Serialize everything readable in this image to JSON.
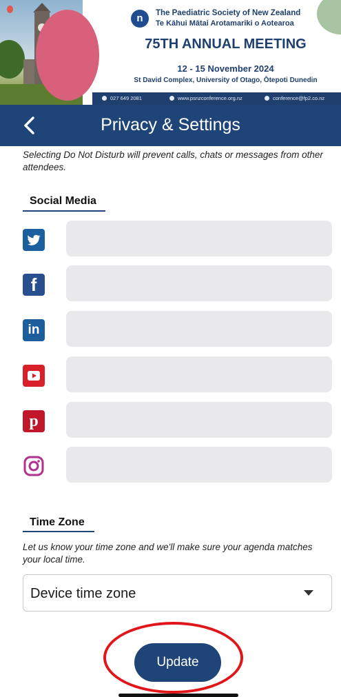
{
  "banner": {
    "org_line1": "The Paediatric Society of New Zealand",
    "org_line2": "Te Kāhui Mātai Arotamariki o Aotearoa",
    "meeting_title": "75TH ANNUAL MEETING",
    "dates": "12 - 15 November 2024",
    "venue": "St David Complex, University of Otago, Ōtepoti Dunedin",
    "phone": "027 649 2081",
    "website": "www.psnzconference.org.nz",
    "email": "conference@fp2.co.nz"
  },
  "navbar": {
    "title": "Privacy & Settings",
    "back_icon": "chevron-left-icon"
  },
  "intro_text": "Selecting Do Not Disturb will prevent calls, chats or messages from other attendees.",
  "social": {
    "heading": "Social Media",
    "items": [
      {
        "network": "twitter",
        "icon": "twitter-icon",
        "value": "",
        "color": "#1a5f9e"
      },
      {
        "network": "facebook",
        "icon": "facebook-icon",
        "value": "",
        "color": "#2a4f8f"
      },
      {
        "network": "linkedin",
        "icon": "linkedin-icon",
        "value": "",
        "color": "#1b5e9b"
      },
      {
        "network": "youtube",
        "icon": "youtube-icon",
        "value": "",
        "color": "#d8202b"
      },
      {
        "network": "pinterest",
        "icon": "pinterest-icon",
        "value": "",
        "color": "#c0182a"
      },
      {
        "network": "instagram",
        "icon": "instagram-icon",
        "value": "",
        "color": "#b2308f"
      }
    ]
  },
  "timezone": {
    "heading": "Time Zone",
    "note": "Let us know your time zone and we'll make sure your agenda matches your local time.",
    "selected": "Device time zone"
  },
  "update_label": "Update",
  "colors": {
    "primary": "#1f4578",
    "field_bg": "#e9e9eb",
    "highlight": "#e0161b"
  }
}
